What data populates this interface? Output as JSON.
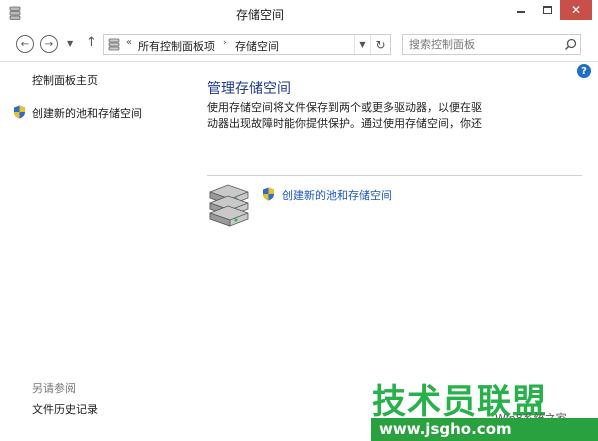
{
  "window": {
    "title": "存储空间"
  },
  "nav": {
    "address_sep": "«",
    "crumb_root": "所有控制面板项",
    "crumb_arrow": "›",
    "crumb_current": "存储空间",
    "search_placeholder": "搜索控制面板"
  },
  "left_pane": {
    "home_link": "控制面板主页",
    "create_link": "创建新的池和存储空间",
    "see_also": "另请参阅",
    "history_link": "文件历史记录"
  },
  "main": {
    "title": "管理存储空间",
    "description": "使用存储空间将文件保存到两个或更多驱动器，以便在驱动器出现故障时能你提供保护。通过使用存储空间，你还",
    "create_link": "创建新的池和存储空间"
  },
  "watermark": {
    "main": "技术员联盟",
    "sub": "Win8系统之家",
    "url": "www.jsgho.com"
  },
  "icons": {
    "title": "storage-icon",
    "back": "arrow-left-icon",
    "forward": "arrow-right-icon",
    "up": "arrow-up-icon",
    "refresh": "refresh-icon",
    "search": "search-icon",
    "help": "help-icon",
    "shield": "uac-shield-icon",
    "disks": "storage-disks-icon"
  },
  "colors": {
    "link": "#1a56c4",
    "heading": "#1e3a8a",
    "close_button": "#c7504a",
    "help": "#1f6fc7",
    "watermark_green": "#27b14a"
  }
}
